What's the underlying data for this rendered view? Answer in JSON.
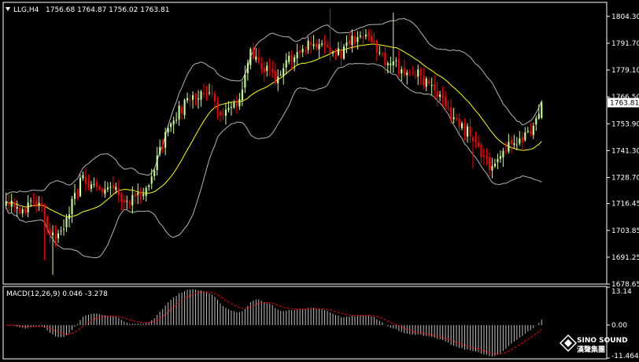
{
  "header": {
    "symbol_timeframe": "LLG,H4",
    "ohlc": "1756.68 1764.87 1756.02 1763.81"
  },
  "indicator": {
    "macd_label": "MACD(12,26,9) 0.046 -3.278"
  },
  "brand": {
    "name": "SINO SOUND",
    "cn": "漢聲集團"
  },
  "colors": {
    "background": "#000000",
    "frame": "#ffffff",
    "bull": "#ccff99",
    "bear": "#ff0000",
    "bands": "#b4b4b4",
    "middle_band": "#ffff00",
    "macd_hist": "#c0c0c0",
    "macd_signal": "#ff0000",
    "cur_price_bg": "#ffffff"
  },
  "chart_data": [
    {
      "type": "candlestick",
      "ylim": [
        1678.65,
        1810.5
      ],
      "y_ticks": [
        "1804.30",
        "1791.70",
        "1779.10",
        "1766.50",
        "1753.90",
        "1741.30",
        "1728.70",
        "1716.45",
        "1703.85",
        "1691.25",
        "1678.65"
      ],
      "current_price": "1763.81",
      "overlays": [
        "bollinger_upper",
        "bollinger_middle",
        "bollinger_lower"
      ],
      "key_points": [
        [
          0,
          1719
        ],
        [
          6,
          1714
        ],
        [
          12,
          1716
        ],
        [
          18,
          1697
        ],
        [
          24,
          1716
        ],
        [
          28,
          1730
        ],
        [
          33,
          1722
        ],
        [
          38,
          1723
        ],
        [
          44,
          1718
        ],
        [
          49,
          1720
        ],
        [
          54,
          1733
        ],
        [
          60,
          1755
        ],
        [
          66,
          1764
        ],
        [
          72,
          1770
        ],
        [
          75,
          1767
        ],
        [
          79,
          1757
        ],
        [
          84,
          1763
        ],
        [
          89,
          1786
        ],
        [
          93,
          1782
        ],
        [
          98,
          1775
        ],
        [
          104,
          1785
        ],
        [
          110,
          1792
        ],
        [
          116,
          1790
        ],
        [
          122,
          1786
        ],
        [
          128,
          1796
        ],
        [
          134,
          1790
        ],
        [
          138,
          1784
        ],
        [
          143,
          1780
        ],
        [
          146,
          1777
        ],
        [
          150,
          1778
        ],
        [
          156,
          1768
        ],
        [
          162,
          1758
        ],
        [
          168,
          1750
        ],
        [
          172,
          1743
        ],
        [
          176,
          1735
        ],
        [
          180,
          1740
        ],
        [
          186,
          1745
        ],
        [
          191,
          1749
        ],
        [
          195,
          1761
        ]
      ],
      "candles": 196
    },
    {
      "type": "bar",
      "series": [
        {
          "name": "MACD",
          "indicator": "histogram"
        },
        {
          "name": "Signal",
          "indicator": "line"
        }
      ],
      "ylim": [
        -11.464,
        13.14
      ],
      "y_ticks": [
        "13.14",
        "0.00",
        "-11.464"
      ],
      "values_last": [
        0.046,
        -3.278
      ]
    }
  ]
}
